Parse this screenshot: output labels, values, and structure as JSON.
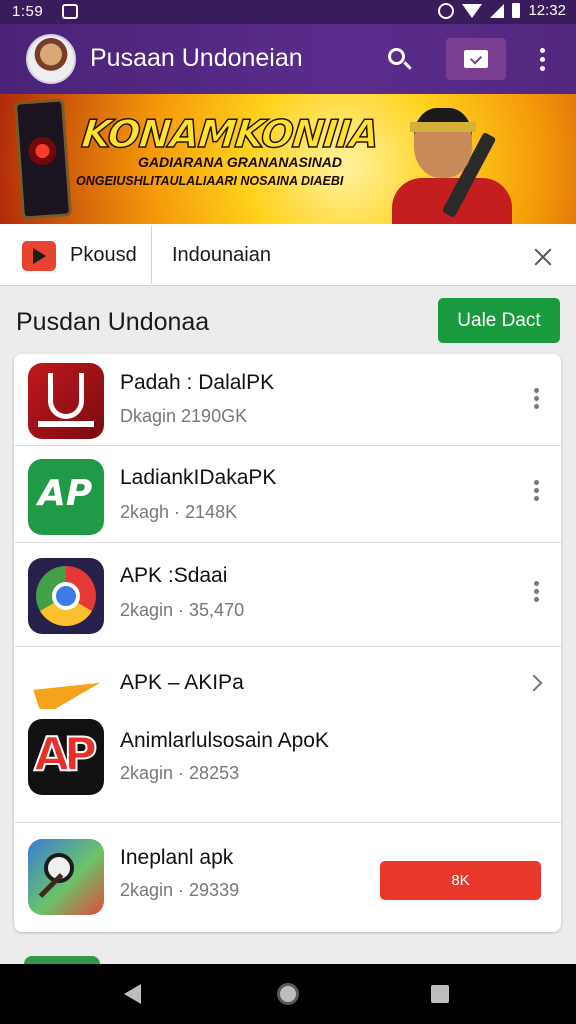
{
  "status_bar": {
    "time_left": "1:59",
    "time_right": "12:32",
    "icons": [
      "notification-icon",
      "alarm-icon",
      "wifi-icon",
      "signal-icon",
      "battery-icon"
    ]
  },
  "app_bar": {
    "title": "Pusaan Undoneian",
    "actions": [
      "search-icon",
      "inbox-icon",
      "more-vert-icon"
    ],
    "color": "#53287f"
  },
  "banner": {
    "headline": "KONAMKONIIA",
    "subline_1": "GADIARANA GRANANASINAD",
    "subline_2": "ONGEIUSHLITAULALIAARI NOSAINA DIAEBI"
  },
  "search": {
    "store_label": "Pkousd",
    "query": "Indounaian"
  },
  "section": {
    "title": "Pusdan Undonaa",
    "action_label": "Uale Dact",
    "action_color": "#199a3f"
  },
  "apps": [
    {
      "name": "Padah : DalalPK",
      "meta": "Dkagin 2190GK",
      "icon": "red-app-icon",
      "trailing": "more"
    },
    {
      "name": "LadiankIDakaPK",
      "meta": "2kagh · 2148K",
      "icon": "ap-green-app-icon",
      "icon_text": "AP",
      "trailing": "more"
    },
    {
      "name": "APK :Sdaai",
      "meta": "2kagin · 35,470",
      "icon": "chrome-app-icon",
      "trailing": "more"
    },
    {
      "name": "APK – AKIPa",
      "meta": "",
      "icon": "arrow-app-icon",
      "trailing": "chevron"
    },
    {
      "name": "Animlarlulsosain ApoK",
      "meta": "2kagin · 28253",
      "icon": "ap-red-app-icon",
      "icon_text": "AP",
      "trailing": "none"
    },
    {
      "name": "Ineplanl apk",
      "meta": "2kagin · 29339",
      "icon": "map-app-icon",
      "trailing": "button",
      "button_label": "8K",
      "button_color": "#e8382b"
    }
  ],
  "nav_bar": {
    "buttons": [
      "back-icon",
      "home-icon",
      "recents-icon"
    ]
  }
}
